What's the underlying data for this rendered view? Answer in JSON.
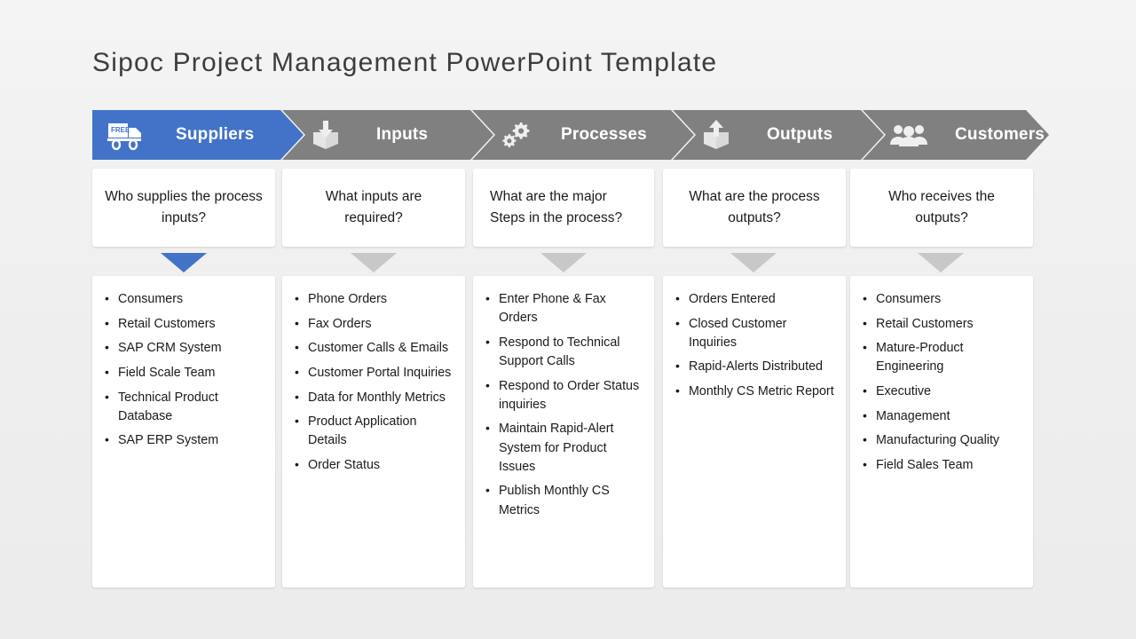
{
  "slide": {
    "title": "Sipoc Project Management PowerPoint Template",
    "background_color": "#efefef"
  },
  "theme": {
    "accent_color": "#4373c8",
    "neutral_color": "#808080",
    "triangle_accent_color": "#4373c8",
    "triangle_neutral_color": "#c8c8c8",
    "header_text_color": "#ffffff",
    "body_text_color": "#1a1a1a"
  },
  "header": {
    "stages": [
      {
        "label": "Suppliers",
        "icon": "delivery-truck-icon",
        "icon_caption": "FREE",
        "color": "#4373c8"
      },
      {
        "label": "Inputs",
        "icon": "box-arrow-down-icon",
        "color": "#808080"
      },
      {
        "label": "Processes",
        "icon": "gears-icon",
        "color": "#808080"
      },
      {
        "label": "Outputs",
        "icon": "box-arrow-up-icon",
        "color": "#808080"
      },
      {
        "label": "Customers",
        "icon": "people-group-icon",
        "color": "#808080"
      }
    ]
  },
  "questions": [
    {
      "text": "Who supplies the process inputs?",
      "align": "center"
    },
    {
      "text": "What inputs are required?",
      "align": "center"
    },
    {
      "text": "What are the major Steps in the process?",
      "align": "left"
    },
    {
      "text": "What are the process outputs?",
      "align": "center"
    },
    {
      "text": "Who receives the outputs?",
      "align": "center"
    }
  ],
  "columns": [
    {
      "stage": "Suppliers",
      "items": [
        "Consumers",
        "Retail Customers",
        "SAP CRM System",
        "Field Scale Team",
        "Technical Product Database",
        "SAP ERP System"
      ]
    },
    {
      "stage": "Inputs",
      "items": [
        "Phone Orders",
        "Fax Orders",
        "Customer Calls & Emails",
        "Customer Portal Inquiries",
        "Data for Monthly Metrics",
        "Product Application Details",
        "Order Status"
      ]
    },
    {
      "stage": "Processes",
      "items": [
        "Enter Phone & Fax Orders",
        "Respond to Technical Support Calls",
        "Respond to Order Status inquiries",
        "Maintain Rapid-Alert System for Product Issues",
        "Publish Monthly CS Metrics"
      ]
    },
    {
      "stage": "Outputs",
      "items": [
        "Orders Entered",
        "Closed Customer Inquiries",
        "Rapid-Alerts Distributed",
        "Monthly CS Metric Report"
      ]
    },
    {
      "stage": "Customers",
      "items": [
        "Consumers",
        "Retail Customers",
        "Mature-Product Engineering",
        "Executive",
        "Management",
        "Manufacturing Quality",
        "Field Sales Team"
      ]
    }
  ]
}
